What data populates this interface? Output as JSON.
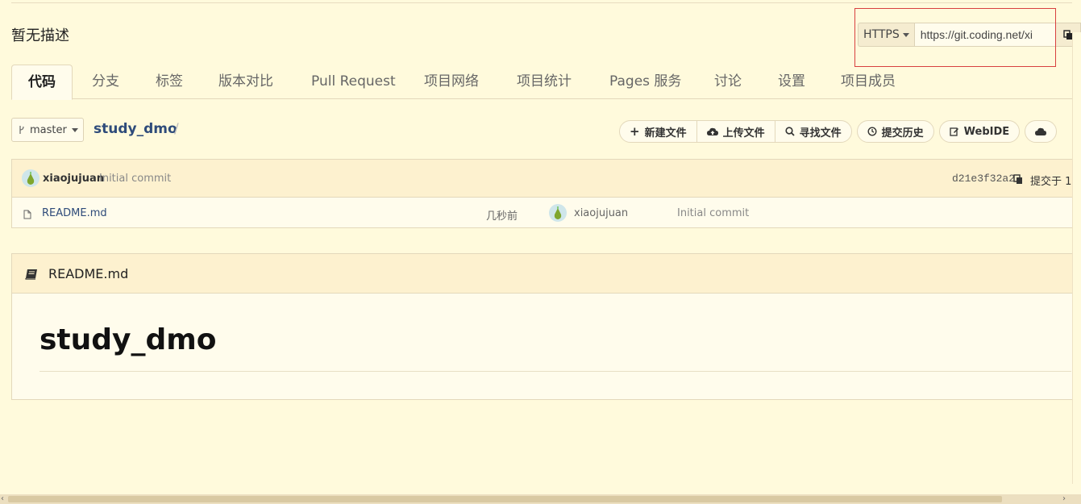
{
  "repo": {
    "description": "暂无描述",
    "name": "study_dmo",
    "branch": "master"
  },
  "clone": {
    "protocol": "HTTPS",
    "url": "https://git.coding.net/xi"
  },
  "tabs": [
    {
      "label": "代码",
      "active": true
    },
    {
      "label": "分支"
    },
    {
      "label": "标签"
    },
    {
      "label": "版本对比"
    },
    {
      "label": "Pull Request"
    },
    {
      "label": "项目网络"
    },
    {
      "label": "项目统计"
    },
    {
      "label": "Pages 服务"
    },
    {
      "label": "讨论"
    },
    {
      "label": "设置"
    },
    {
      "label": "项目成员"
    }
  ],
  "toolbar": {
    "new_file": "新建文件",
    "upload_file": "上传文件",
    "find_file": "寻找文件",
    "history": "提交历史",
    "webide": "WebIDE"
  },
  "last_commit": {
    "user": "xiaojujuan",
    "message": "Initial commit",
    "hash": "d21e3f32a2",
    "time": "提交于 1"
  },
  "files": [
    {
      "name": "README.md",
      "age": "几秒前",
      "author": "xiaojujuan",
      "message": "Initial commit"
    }
  ],
  "readme": {
    "title": "README.md",
    "heading": "study_dmo"
  },
  "colors": {
    "background": "#fffadc",
    "link": "#2e4b7a",
    "highlight_box": "#d8403f"
  }
}
